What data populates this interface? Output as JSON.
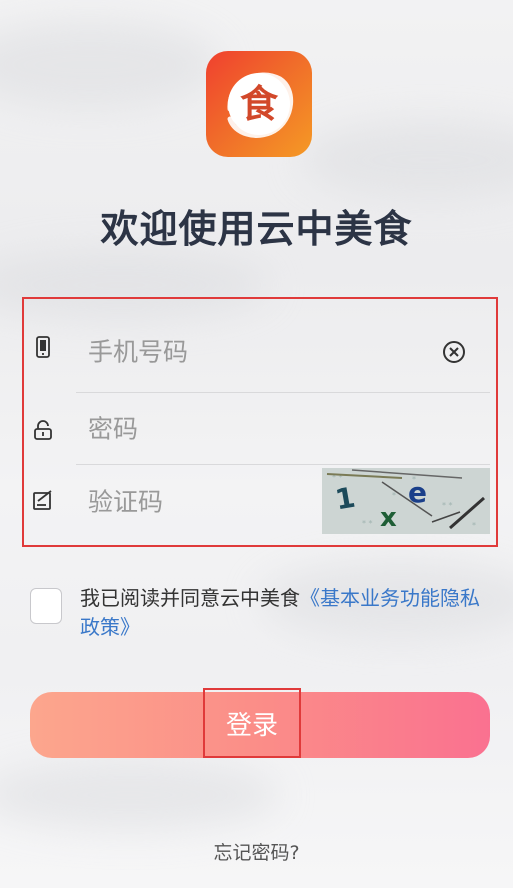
{
  "app": {
    "logo_char": "食",
    "title": "欢迎使用云中美食",
    "brand_color": "#f06a2a"
  },
  "form": {
    "phone": {
      "placeholder": "手机号码",
      "icon": "phone-icon"
    },
    "password": {
      "placeholder": "密码",
      "icon": "lock-icon"
    },
    "captcha": {
      "placeholder": "验证码",
      "icon": "edit-icon",
      "image_text": "1xe"
    }
  },
  "agreement": {
    "text": "我已阅读并同意云中美食",
    "link": "《基本业务功能隐私政策》",
    "link_color": "#3a78c9"
  },
  "login": {
    "label": "登录"
  },
  "forgot": {
    "label": "忘记密码?"
  }
}
